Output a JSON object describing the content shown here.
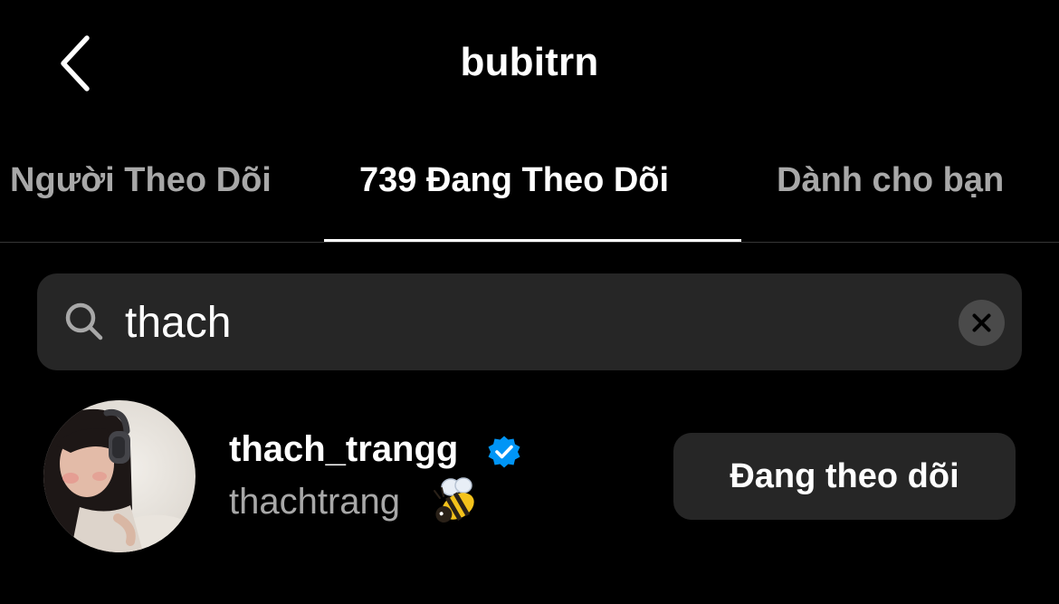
{
  "header": {
    "title": "bubitrn",
    "back_icon": "chevron-left-icon"
  },
  "tabs": [
    {
      "label": "Người Theo Dõi",
      "active": false
    },
    {
      "label": "739 Đang Theo Dõi",
      "active": true
    },
    {
      "label": "Dành cho bạn",
      "active": false
    }
  ],
  "search": {
    "value": "thach",
    "icon": "search-icon",
    "clear_icon": "clear-icon"
  },
  "results": [
    {
      "username": "thach_trangg",
      "verified": true,
      "full_name": "thachtrang",
      "emoji": "bee-icon",
      "button_label": "Đang theo dõi"
    }
  ],
  "colors": {
    "background": "#000000",
    "surface": "#262626",
    "text_primary": "#ffffff",
    "text_secondary": "#a8a8a8",
    "verified_blue": "#0095f6"
  }
}
